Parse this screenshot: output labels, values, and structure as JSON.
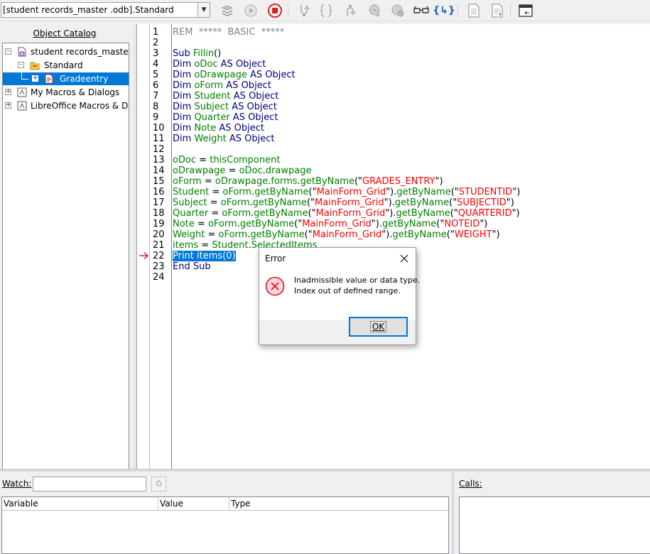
{
  "toolbar": {
    "library_selector": "[student records_master .odb].Standard",
    "buttons": [
      {
        "name": "modules",
        "icon": "library-icon"
      },
      {
        "name": "run",
        "icon": "play-icon"
      },
      {
        "name": "stop",
        "icon": "stop-icon"
      },
      {
        "name": "step-into",
        "icon": "step-into-icon"
      },
      {
        "name": "step-over",
        "icon": "step-over-icon"
      },
      {
        "name": "step-out",
        "icon": "step-out-icon"
      },
      {
        "name": "breakpoint",
        "icon": "breakpoint-icon"
      },
      {
        "name": "manage-breakpoints",
        "icon": "manage-breakpoints-icon"
      },
      {
        "name": "watch",
        "icon": "glasses-icon"
      },
      {
        "name": "find-parentheses",
        "icon": "braces-icon"
      },
      {
        "name": "import-basic",
        "icon": "import-icon"
      },
      {
        "name": "export-basic",
        "icon": "export-icon"
      },
      {
        "name": "dialog",
        "icon": "dialog-icon"
      }
    ],
    "accent_color": "#0078d7",
    "stop_color": "#e02020"
  },
  "catalog": {
    "title": "Object Catalog",
    "nodes": [
      {
        "label": "student records_master .odb",
        "level": 0,
        "expanded": true,
        "icon": "database-icon"
      },
      {
        "label": "Standard",
        "level": 1,
        "expanded": true,
        "icon": "folder-icon"
      },
      {
        "label": "Gradeentry",
        "level": 2,
        "expanded": false,
        "icon": "module-icon",
        "selected": true
      },
      {
        "label": "My Macros & Dialogs",
        "level": 0,
        "expanded": false,
        "icon": "macros-icon"
      },
      {
        "label": "LibreOffice Macros & Dialogs",
        "level": 0,
        "expanded": false,
        "icon": "macros-icon"
      }
    ]
  },
  "editor": {
    "current_line": 22,
    "lines": [
      {
        "n": "1",
        "text": "REM  *****  BASIC  *****"
      },
      {
        "n": "2",
        "text": ""
      },
      {
        "n": "3",
        "text": "Sub Fillin()"
      },
      {
        "n": "4",
        "text": "Dim oDoc AS Object"
      },
      {
        "n": "5",
        "text": "Dim oDrawpage AS Object"
      },
      {
        "n": "6",
        "text": "Dim oForm AS Object"
      },
      {
        "n": "7",
        "text": "Dim Student AS Object"
      },
      {
        "n": "8",
        "text": "Dim Subject AS Object"
      },
      {
        "n": "9",
        "text": "Dim Quarter AS Object"
      },
      {
        "n": "10",
        "text": "Dim Note AS Object"
      },
      {
        "n": "11",
        "text": "Dim Weight AS Object"
      },
      {
        "n": "12",
        "text": ""
      },
      {
        "n": "13",
        "text": "oDoc = thisComponent"
      },
      {
        "n": "14",
        "text": "oDrawpage = oDoc.drawpage"
      },
      {
        "n": "15",
        "text": "oForm = oDrawpage.forms.getByName(\"GRADES_ENTRY\")"
      },
      {
        "n": "16",
        "text": "Student = oForm.getByName(\"MainForm_Grid\").getByName(\"STUDENTID\")"
      },
      {
        "n": "17",
        "text": "Subject = oForm.getByName(\"MainForm_Grid\").getByName(\"SUBJECTID\")"
      },
      {
        "n": "18",
        "text": "Quarter = oForm.getByName(\"MainForm_Grid\").getByName(\"QUARTERID\")"
      },
      {
        "n": "19",
        "text": "Note = oForm.getByName(\"MainForm_Grid\").getByName(\"NOTEID\")"
      },
      {
        "n": "20",
        "text": "Weight = oForm.getByName(\"MainForm_Grid\").getByName(\"WEIGHT\")"
      },
      {
        "n": "21",
        "text": "items = Student.SelectedItems"
      },
      {
        "n": "22",
        "text": "Print items(0)"
      },
      {
        "n": "23",
        "text": "End Sub"
      },
      {
        "n": "24",
        "text": ""
      }
    ],
    "colors": {
      "keyword": "#000080",
      "identifier": "#008000",
      "string": "#ff0000",
      "comment": "#808080"
    }
  },
  "watch": {
    "label": "Watch:",
    "value": "",
    "columns": [
      "Variable",
      "Value",
      "Type"
    ]
  },
  "calls": {
    "label": "Calls:"
  },
  "dialog": {
    "title": "Error",
    "message_line1": "Inadmissible value or data type.",
    "message_line2": "Index out of defined range.",
    "ok_label": "OK",
    "error_color": "#e81123"
  }
}
